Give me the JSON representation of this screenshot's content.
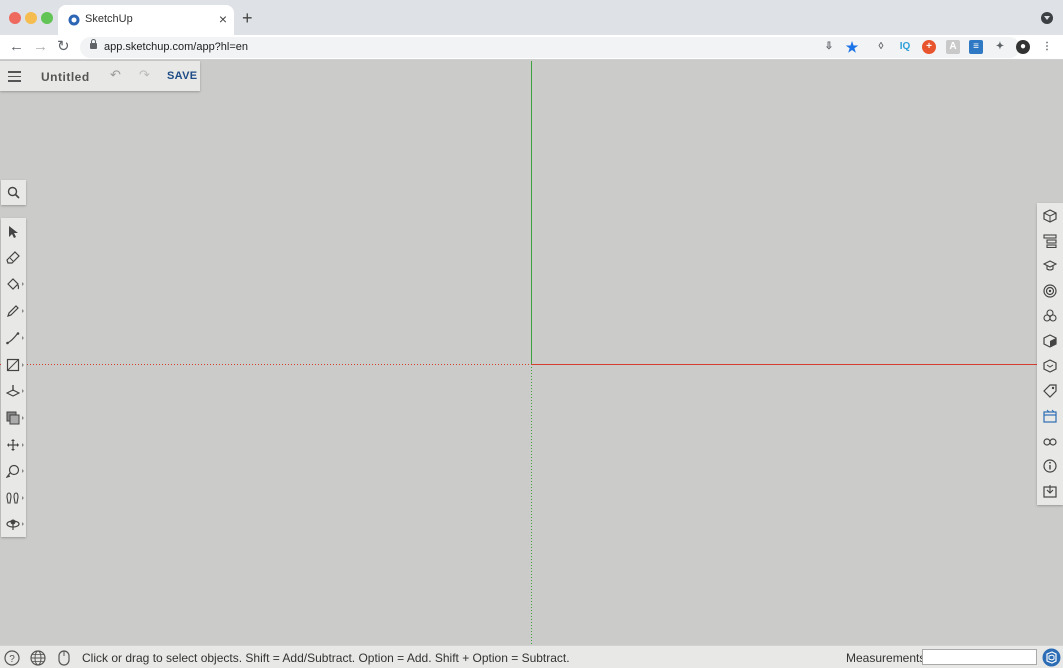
{
  "browser": {
    "tab_title": "SketchUp",
    "url": "app.sketchup.com/app?hl=en"
  },
  "app": {
    "document_title": "Untitled",
    "save_label": "SAVE"
  },
  "status": {
    "hint": "Click or drag to select objects. Shift = Add/Subtract. Option = Add. Shift + Option = Subtract.",
    "measurements_label": "Measurements",
    "measurements_value": ""
  },
  "left_tools": [
    "select-tool",
    "eraser-tool",
    "paint-bucket-tool",
    "line-tool",
    "arc-tool",
    "rectangle-tool",
    "push-pull-tool",
    "offset-tool",
    "move-tool",
    "tape-measure-tool",
    "walk-tool",
    "orbit-tool"
  ],
  "right_panels": [
    "entity-info-panel",
    "outliner-panel",
    "instructor-panel",
    "materials-panel",
    "components-panel",
    "styles-panel",
    "display-panel",
    "tags-panel",
    "scenes-panel",
    "shadows-panel",
    "model-info-panel",
    "solar-north-panel"
  ],
  "colors": {
    "viewport_background": "#cbcbc9",
    "red_axis": "#d23f2f",
    "green_axis": "#3ea33e",
    "save_text": "#1d4c86"
  }
}
